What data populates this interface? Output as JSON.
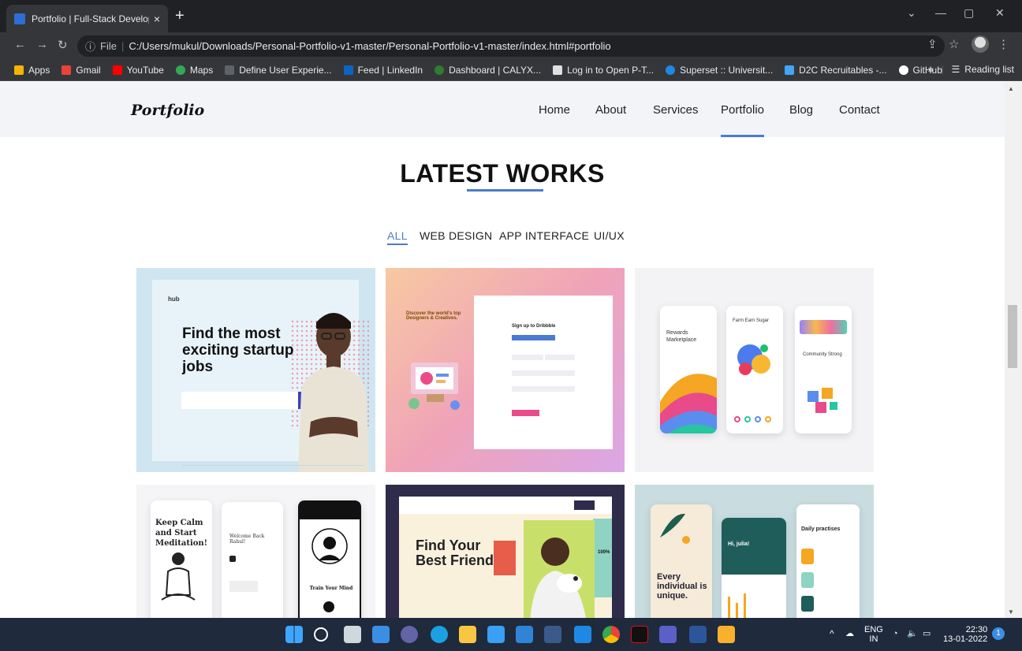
{
  "browser": {
    "tab_title": "Portfolio | Full-Stack Developer",
    "tab_close": "×",
    "new_tab": "+",
    "url_prefix": "File",
    "url": "C:/Users/mukul/Downloads/Personal-Portfolio-v1-master/Personal-Portfolio-v1-master/index.html#portfolio",
    "bookmarks": [
      {
        "label": "Apps",
        "color": "#f4b400"
      },
      {
        "label": "Gmail",
        "color": "#ea4335"
      },
      {
        "label": "YouTube",
        "color": "#ff0000"
      },
      {
        "label": "Maps",
        "color": "#34a853"
      },
      {
        "label": "Define User Experie...",
        "color": "#5f6368"
      },
      {
        "label": "Feed | LinkedIn",
        "color": "#0a66c2"
      },
      {
        "label": "Dashboard | CALYX...",
        "color": "#2e7d32"
      },
      {
        "label": "Log in to Open P-T...",
        "color": "#e0e0e0"
      },
      {
        "label": "Superset :: Universit...",
        "color": "#1e88e5"
      },
      {
        "label": "D2C Recruitables -...",
        "color": "#42a5f5"
      },
      {
        "label": "GitHub",
        "color": "#ffffff"
      }
    ],
    "more_bookmarks": "»",
    "reading_list": "Reading list"
  },
  "site": {
    "logo": "Portfolio",
    "nav": [
      "Home",
      "About",
      "Services",
      "Portfolio",
      "Blog",
      "Contact"
    ],
    "active_nav": "Portfolio",
    "section_title": "LATEST WORKS",
    "filters": [
      "ALL",
      "WEB DESIGN",
      "APP INTERFACE",
      "UI/UX"
    ],
    "active_filter": "ALL",
    "works": [
      {
        "headline": "Find the most exciting startup jobs",
        "brand": "hub"
      },
      {
        "headline": "Discover the world's top Designers & Creatives.",
        "form_title": "Sign up to Dribbble"
      },
      {
        "headline": "Rewards Marketplace",
        "sub1": "Farm Earn Sugar",
        "sub2": "Community Strong"
      },
      {
        "headline": "Keep Calm and Start Meditation!",
        "sub1": "Welcome Back Rahul!",
        "sub2": "Train Your Mind"
      },
      {
        "headline": "Find Your Best Friend",
        "badge": "100%"
      },
      {
        "headline": "Every individual is unique.",
        "sub1": "Hi, julia!",
        "sub2": "Daily practises"
      }
    ]
  },
  "taskbar": {
    "lang_top": "ENG",
    "lang_bottom": "IN",
    "time": "22:30",
    "date": "13-01-2022",
    "notifications": "1"
  }
}
